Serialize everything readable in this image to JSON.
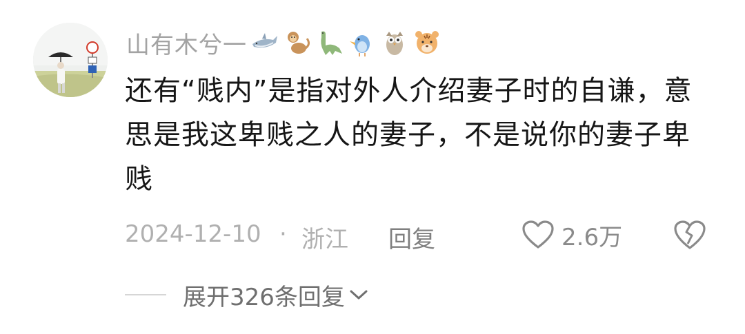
{
  "comment": {
    "username": "山有木兮一",
    "badges": [
      "shark-icon",
      "monkey-icon",
      "dinosaur-icon",
      "bird-icon",
      "owl-icon",
      "tiger-icon"
    ],
    "content": "还有“贱内”是指对外人介绍妻子时的自谦，意思是我这卑贱之人的妻子，不是说你的妻子卑贱",
    "date": "2024-12-10",
    "separator": "·",
    "location": "浙江",
    "reply_label": "回复",
    "like_count": "2.6万",
    "expand_label": "展开326条回复"
  },
  "colors": {
    "username": "#a3a3a3",
    "content": "#161616",
    "meta": "#b0b0b0",
    "action": "#7f7f7f"
  }
}
